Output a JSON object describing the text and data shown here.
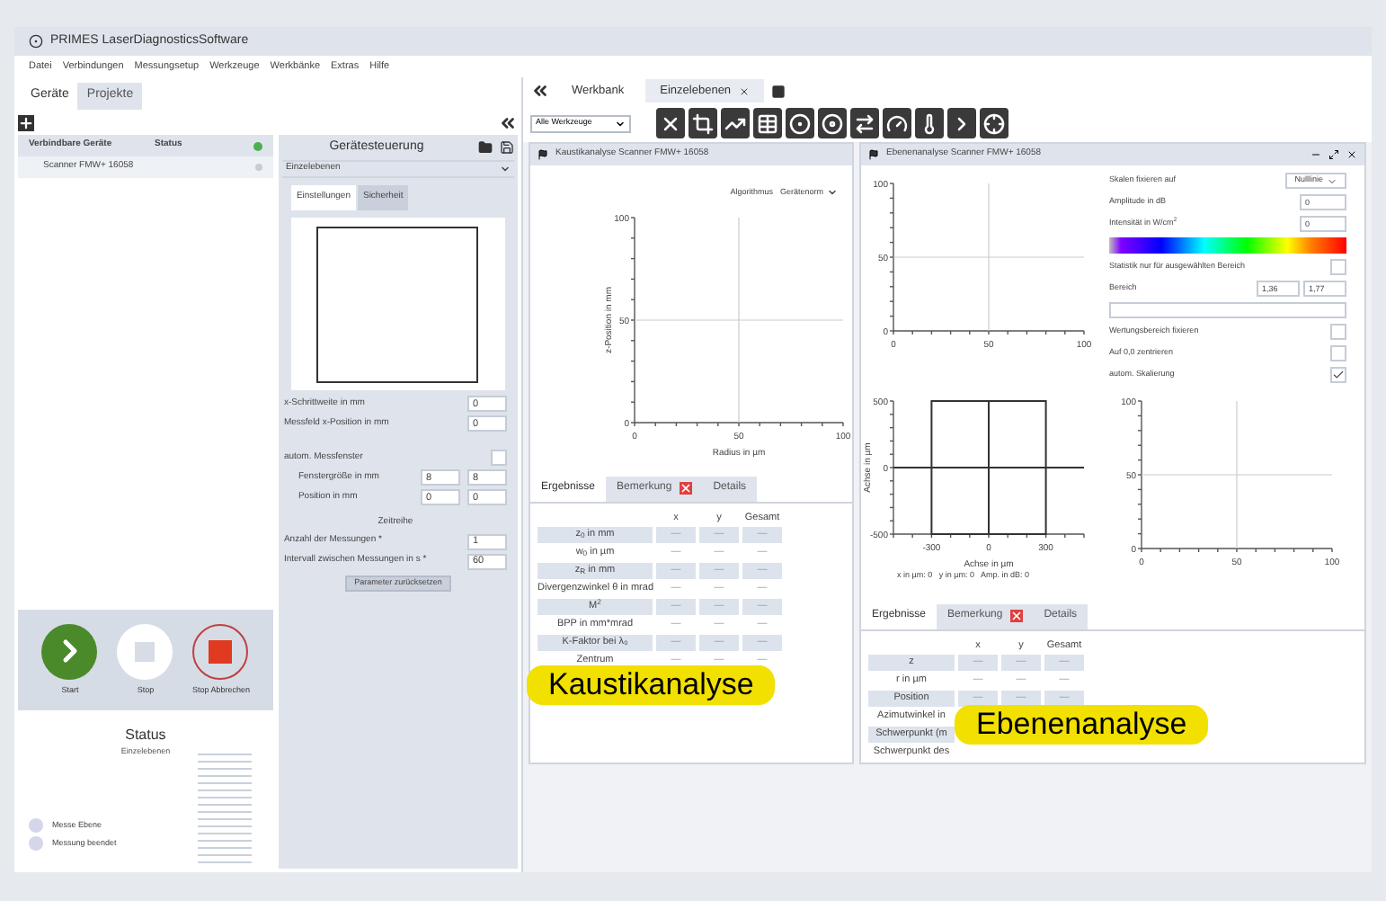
{
  "window": {
    "title": "PRIMES LaserDiagnosticsSoftware"
  },
  "menu": [
    "Datei",
    "Verbindungen",
    "Messungsetup",
    "Werkzeuge",
    "Werkbänke",
    "Extras",
    "Hilfe"
  ],
  "side_tabs": [
    {
      "label": "Geräte",
      "selected": true
    },
    {
      "label": "Projekte",
      "selected": false
    }
  ],
  "devices": [
    {
      "kind": "group",
      "label": "Verbindbare Geräte",
      "status": "Status",
      "color": "#4caf50"
    },
    {
      "kind": "device",
      "label": "Scanner FMW+ 16058",
      "color": "#c8ccd4"
    }
  ],
  "control": {
    "title": "Gerätesteuerung",
    "mode": "Einzelebenen",
    "tabs": [
      {
        "label": "Einstellungen",
        "selected": true
      },
      {
        "label": "Sicherheit",
        "selected": false
      }
    ],
    "fields": [
      {
        "kind": "single",
        "label": "x-Schrittweite in mm",
        "value": "0"
      },
      {
        "kind": "single",
        "label": "Messfeld x-Position in mm",
        "value": "0"
      },
      {
        "kind": "check",
        "label": "autom. Messfenster",
        "checked": false
      },
      {
        "kind": "pair",
        "label": "Fenstergröße in mm",
        "values": [
          "8",
          "8"
        ]
      },
      {
        "kind": "pair",
        "label": "Position in mm",
        "values": [
          "0",
          "0"
        ]
      },
      {
        "kind": "heading",
        "label": "Zeitreihe"
      },
      {
        "kind": "single",
        "label": "Anzahl der Messungen *",
        "value": "1"
      },
      {
        "kind": "single",
        "label": "Intervall zwischen Messungen in s *",
        "value": "60"
      }
    ],
    "reset_button": "Parameter zurücksetzen"
  },
  "actions": [
    {
      "kind": "start",
      "label": "Start"
    },
    {
      "kind": "stop",
      "label": "Stop"
    },
    {
      "kind": "abort",
      "label": "Stop Abbrechen"
    }
  ],
  "status": {
    "title": "Status",
    "mode": "Einzelebenen",
    "steps": [
      "Messe Ebene",
      "Messung beendet"
    ]
  },
  "workbench": {
    "tabs": [
      {
        "label": "Werkbank",
        "selected": false,
        "closable": false
      },
      {
        "label": "Einzelebenen",
        "selected": true,
        "closable": true
      }
    ],
    "tool_filter": "Alle Werkzeuge"
  },
  "caustic": {
    "title": "Kaustikanalyse Scanner FMW+ 16058",
    "algorithm_label": "Algorithmus",
    "algorithm": "Gerätenorm",
    "chart": {
      "xlabel": "Radius in µm",
      "ylabel": "z-Position in mm",
      "xticks": [
        "0",
        "50",
        "100"
      ],
      "yticks": [
        "100",
        "50",
        "0"
      ]
    },
    "result_tabs": [
      {
        "label": "Ergebnisse",
        "selected": true,
        "flag": false
      },
      {
        "label": "Bemerkung",
        "selected": false,
        "flag": true
      },
      {
        "label": "Details",
        "selected": false,
        "flag": false
      }
    ],
    "columns": [
      "x",
      "y",
      "Gesamt"
    ],
    "rows": [
      {
        "label": "z$_{0}$ in mm",
        "values": [
          "—",
          "—",
          "—"
        ]
      },
      {
        "label": "w$_{0}$ in µm",
        "values": [
          "—",
          "—",
          "—"
        ]
      },
      {
        "label": "z$_{R}$ in mm",
        "values": [
          "—",
          "—",
          "—"
        ]
      },
      {
        "label": "Divergenzwinkel θ in mrad",
        "values": [
          "—",
          "—",
          "—"
        ]
      },
      {
        "label": "M$^{2}$",
        "values": [
          "—",
          "—",
          "—"
        ]
      },
      {
        "label": "BPP in mm*mrad",
        "values": [
          "—",
          "—",
          "—"
        ]
      },
      {
        "label": "K-Faktor bei λ₀",
        "values": [
          "—",
          "—",
          "—"
        ]
      },
      {
        "label": "Zentrum",
        "values": [
          "—",
          "—",
          "—"
        ]
      }
    ],
    "badge": "Kaustikanalyse"
  },
  "plane": {
    "title": "Ebenenanalyse Scanner FMW+ 16058",
    "top_chart": {
      "xticks": [
        "0",
        "50",
        "100"
      ],
      "yticks": [
        "100",
        "50",
        "0"
      ]
    },
    "settings": [
      {
        "kind": "select",
        "label": "Skalen fixieren auf",
        "value": "Nulllinie"
      },
      {
        "kind": "input",
        "label": "Amplitude in dB",
        "value": "0"
      },
      {
        "kind": "input",
        "label": "Intensität in W/cm$^{2}$",
        "value": "0"
      },
      {
        "kind": "colorbar"
      },
      {
        "kind": "check",
        "label": "Statistik nur für ausgewählten Bereich",
        "checked": false
      },
      {
        "kind": "range",
        "label": "Bereich",
        "values": [
          "1,36",
          "1,77"
        ]
      },
      {
        "kind": "scale"
      },
      {
        "kind": "check",
        "label": "Wertungsbereich fixieren",
        "checked": false
      },
      {
        "kind": "check",
        "label": "Auf 0,0 zentrieren",
        "checked": false
      },
      {
        "kind": "check",
        "label": "autom. Skalierung",
        "checked": true
      }
    ],
    "cross_chart": {
      "xlabel": "Achse in µm",
      "ylabel": "Achse in µm",
      "xticks": [
        "-300",
        "0",
        "300"
      ],
      "yticks": [
        "500",
        "0",
        "-500"
      ]
    },
    "readout": "x in µm: 0   y in µm: 0   Amp. in dB: 0",
    "right_chart": {
      "xticks": [
        "0",
        "50",
        "100"
      ],
      "yticks": [
        "100",
        "50",
        "0"
      ]
    },
    "result_tabs": [
      {
        "label": "Ergebnisse",
        "selected": true,
        "flag": false
      },
      {
        "label": "Bemerkung",
        "selected": false,
        "flag": true
      },
      {
        "label": "Details",
        "selected": false,
        "flag": false
      }
    ],
    "columns": [
      "x",
      "y",
      "Gesamt"
    ],
    "rows": [
      {
        "label": "z",
        "values": [
          "—",
          "—",
          "—"
        ]
      },
      {
        "label": "r in µm",
        "values": [
          "—",
          "—",
          "—"
        ]
      },
      {
        "label": "Position",
        "values": [
          "—",
          "—",
          "—"
        ]
      },
      {
        "label": "Azimutwinkel in",
        "values": []
      },
      {
        "label": "Schwerpunkt (m",
        "values": []
      },
      {
        "label": "Schwerpunkt des",
        "values": []
      }
    ],
    "badge": "Ebenenanalyse"
  }
}
